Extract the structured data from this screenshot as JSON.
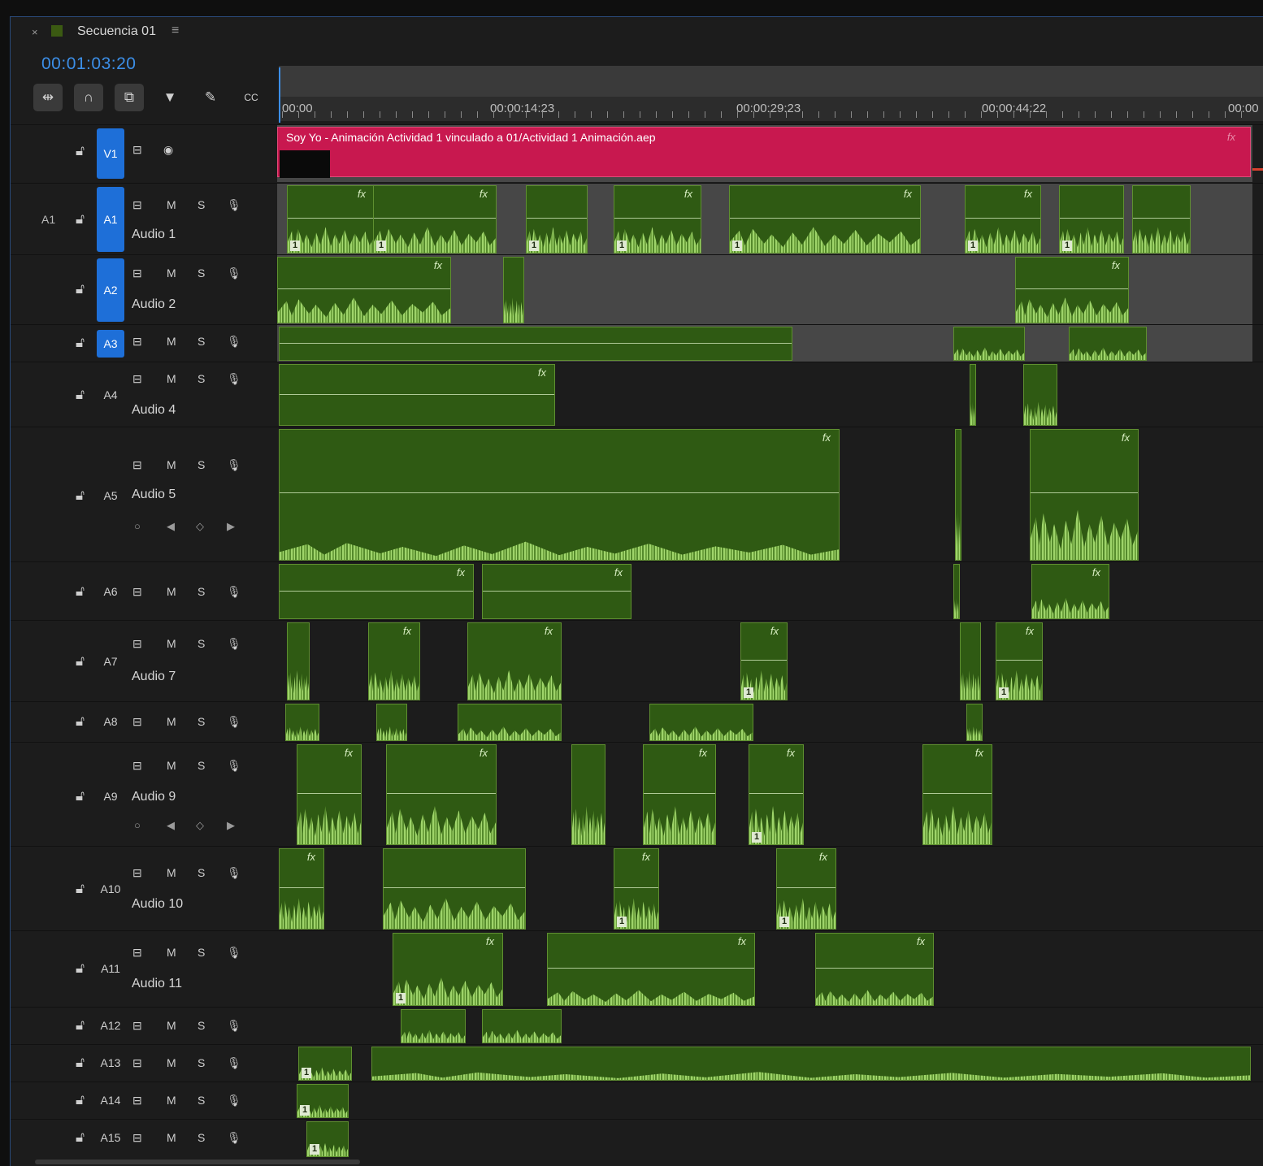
{
  "tab": {
    "close": "×",
    "title": "Secuencia 01",
    "menu": "≡"
  },
  "timecode": "00:01:03:20",
  "tools": [
    "insert-icon",
    "snap-icon",
    "linked-selection-icon",
    "marker-icon",
    "wrench-icon",
    "captions-icon"
  ],
  "ruler": {
    "labels": [
      "00:00",
      "00:00:14:23",
      "00:00:29:23",
      "00:00:44:22",
      "00:00"
    ]
  },
  "video_clip": {
    "title": "Soy Yo - Animación Actividad 1 vinculado a 01/Actividad 1 Animación.aep",
    "fx": "fx"
  },
  "icons": {
    "m": "M",
    "s": "S"
  },
  "tracks": [
    {
      "id": "V1",
      "kind": "video",
      "selected": true
    },
    {
      "id": "A1",
      "kind": "audio",
      "name": "Audio 1",
      "selected": true,
      "source": "A1"
    },
    {
      "id": "A2",
      "kind": "audio",
      "name": "Audio 2",
      "selected": true
    },
    {
      "id": "A3",
      "kind": "audio",
      "selected": true
    },
    {
      "id": "A4",
      "kind": "audio",
      "name": "Audio 4"
    },
    {
      "id": "A5",
      "kind": "audio",
      "name": "Audio 5"
    },
    {
      "id": "A6",
      "kind": "audio"
    },
    {
      "id": "A7",
      "kind": "audio",
      "name": "Audio 7"
    },
    {
      "id": "A8",
      "kind": "audio"
    },
    {
      "id": "A9",
      "kind": "audio",
      "name": "Audio 9"
    },
    {
      "id": "A10",
      "kind": "audio",
      "name": "Audio 10"
    },
    {
      "id": "A11",
      "kind": "audio",
      "name": "Audio 11"
    },
    {
      "id": "A12",
      "kind": "audio"
    },
    {
      "id": "A13",
      "kind": "audio"
    },
    {
      "id": "A14",
      "kind": "audio"
    },
    {
      "id": "A15",
      "kind": "audio"
    }
  ]
}
